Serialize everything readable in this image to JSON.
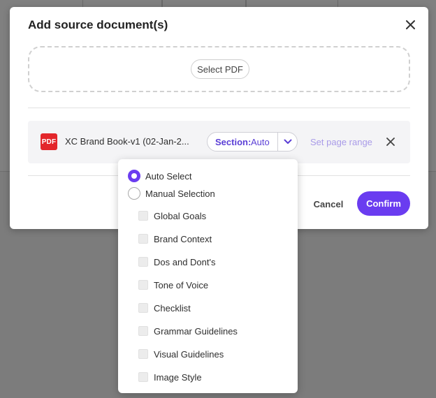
{
  "modal": {
    "title": "Add source document(s)",
    "select_pdf_label": "Select PDF",
    "cancel_label": "Cancel",
    "confirm_label": "Confirm"
  },
  "file": {
    "badge": "PDF",
    "name": "XC Brand Book-v1 (02-Jan-2...",
    "section_label": "Section:",
    "section_value": "Auto",
    "page_range_label": "Set page range"
  },
  "dropdown": {
    "radios": [
      {
        "label": "Auto Select",
        "checked": true
      },
      {
        "label": "Manual Selection",
        "checked": false
      }
    ],
    "sections": [
      "Global Goals",
      "Brand Context",
      "Dos and Dont's",
      "Tone of Voice",
      "Checklist",
      "Grammar Guidelines",
      "Visual Guidelines",
      "Image Style"
    ]
  },
  "colors": {
    "accent": "#6a3cf0",
    "accent_text": "#5b3fd6",
    "link_disabled": "#a99be8",
    "pdf_red": "#e3262b"
  },
  "icons": {
    "close": "close-icon",
    "chevron": "chevron-down-icon",
    "remove": "close-icon"
  }
}
